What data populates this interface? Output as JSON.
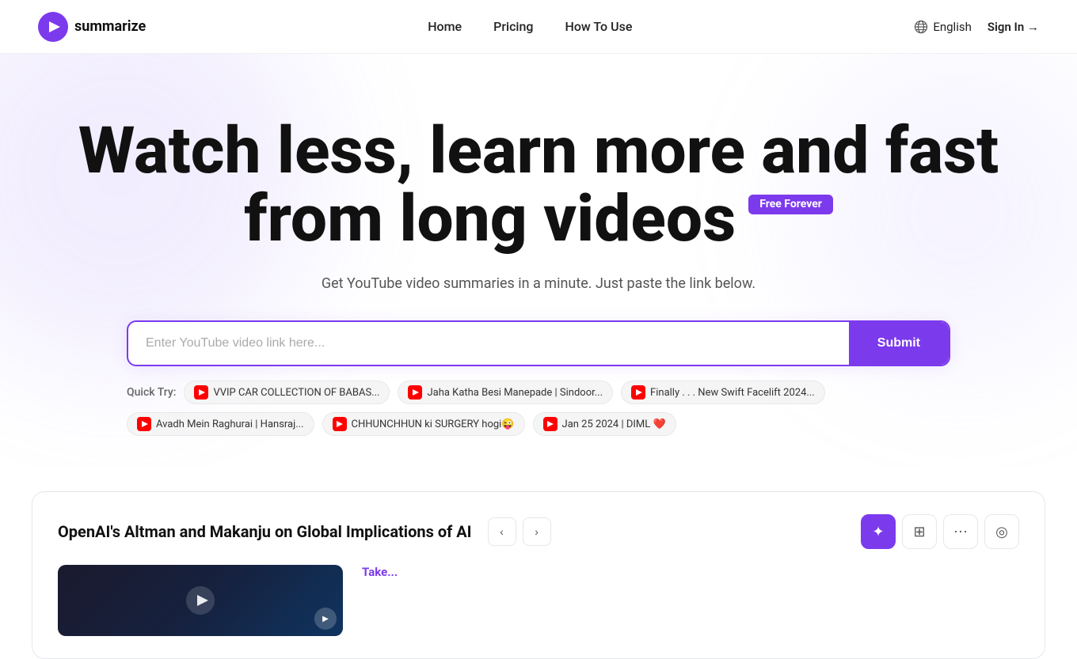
{
  "nav": {
    "logo_text": "summarize",
    "links": [
      {
        "label": "Home",
        "href": "#"
      },
      {
        "label": "Pricing",
        "href": "#"
      },
      {
        "label": "How To Use",
        "href": "#"
      }
    ],
    "language": "English",
    "sign_in": "Sign In →"
  },
  "hero": {
    "title_line1": "Watch less, learn more and fast",
    "title_line2_start": "from long videos",
    "free_badge": "Free Forever",
    "subtitle": "Get YouTube video summaries in a minute. Just paste the link below."
  },
  "search": {
    "placeholder": "Enter YouTube video link here...",
    "submit_label": "Submit"
  },
  "quick_try": {
    "label": "Quick Try:",
    "chips": [
      {
        "text": "VVIP CAR COLLECTION OF BABAS..."
      },
      {
        "text": "Jaha Katha Besi Manepade | Sindoor..."
      },
      {
        "text": "Finally . . . New Swift Facelift 2024..."
      },
      {
        "text": "Avadh Mein Raghurai | Hansraj..."
      },
      {
        "text": "CHHUNCHHUN ki SURGERY hogi😜"
      },
      {
        "text": "Jan 25 2024 | DIML ❤️"
      }
    ]
  },
  "bottom_card": {
    "title": "OpenAI's Altman and Makanju on Global Implications of AI",
    "tools": [
      {
        "icon": "✦",
        "active": true
      },
      {
        "icon": "⊞",
        "active": false
      },
      {
        "icon": "⋯",
        "active": false
      },
      {
        "icon": "◎",
        "active": false
      }
    ],
    "summary_title": "Take..."
  }
}
